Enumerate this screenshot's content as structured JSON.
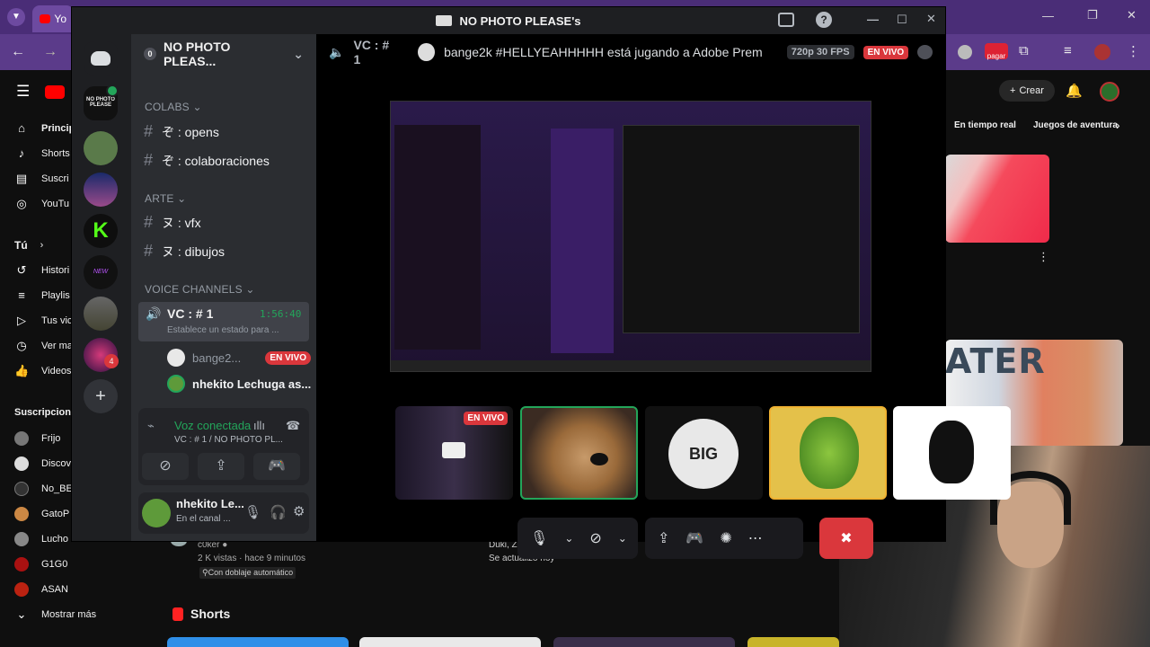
{
  "browser": {
    "tab_label": "Yo",
    "tab_icon": "youtube-icon",
    "win_controls": [
      "—",
      "❐",
      "✕"
    ]
  },
  "youtube": {
    "sidebar": {
      "items": [
        {
          "icon": "home-icon",
          "label": "Princip"
        },
        {
          "icon": "shorts-icon",
          "label": "Shorts"
        },
        {
          "icon": "subscriptions-icon",
          "label": "Suscri"
        },
        {
          "icon": "youtube-music-icon",
          "label": "YouTu"
        }
      ],
      "you_label": "Tú",
      "you_items": [
        {
          "icon": "history-icon",
          "label": "Histori"
        },
        {
          "icon": "playlists-icon",
          "label": "Playlis"
        },
        {
          "icon": "your-videos-icon",
          "label": "Tus vic"
        },
        {
          "icon": "watch-later-icon",
          "label": "Ver ma"
        },
        {
          "icon": "liked-icon",
          "label": "Videos"
        }
      ],
      "subs_title": "Suscripcione",
      "subs": [
        "Frijo",
        "Discov",
        "No_BE",
        "GatoP",
        "Lucho",
        "G1G0",
        "ASAN"
      ],
      "show_more": "Mostrar más"
    },
    "header": {
      "create": "Crear"
    },
    "chips": [
      "En tiempo real",
      "Juegos de aventura"
    ],
    "video_meta": {
      "channel": "c0ker",
      "views": "2 K vistas · hace 9 minutos",
      "dub": "Con doblaje automático",
      "mid_line1": "Duki, Zell, Lucho SSJ y muchos más",
      "mid_line2": "Se actualizó hoy"
    },
    "shorts_label": "Shorts",
    "thumb_text": "ATER"
  },
  "discord": {
    "window_title": "NO PHOTO PLEASE's",
    "server_name": "NO PHOTO PLEAS...",
    "server_count": "0",
    "categories": {
      "colabs": "COLABS",
      "arte": "ARTE",
      "voice": "VOICE CHANNELS"
    },
    "channels": {
      "opens": "ぞ : opens",
      "colaboraciones": "ぞ : colaboraciones",
      "vfx": "ヌ : vfx",
      "dibujos": "ヌ : dibujos"
    },
    "vc": {
      "name": "VC : # 1",
      "time": "1:56:40",
      "status": "Establece un estado para ...",
      "members": [
        {
          "name": "bange2...",
          "live": "EN VIVO"
        },
        {
          "name": "nhekito Lechuga as..."
        }
      ]
    },
    "voice_panel": {
      "title": "Voz conectada",
      "sub": "VC : # 1 / NO PHOTO PL..."
    },
    "user": {
      "name": "nhekito Le...",
      "status": "En el canal ..."
    },
    "stage": {
      "vc_label": "VC : # 1",
      "activity": "bange2k #HELLYEAHHHHH está jugando a Adobe Prem",
      "quality": "720p 30 FPS",
      "live": "EN VIVO",
      "tile_live": "EN VIVO",
      "tile_big": "BIG"
    },
    "colors": {
      "green": "#23a55a",
      "red": "#da373c",
      "blurple": "#5865f2"
    }
  }
}
